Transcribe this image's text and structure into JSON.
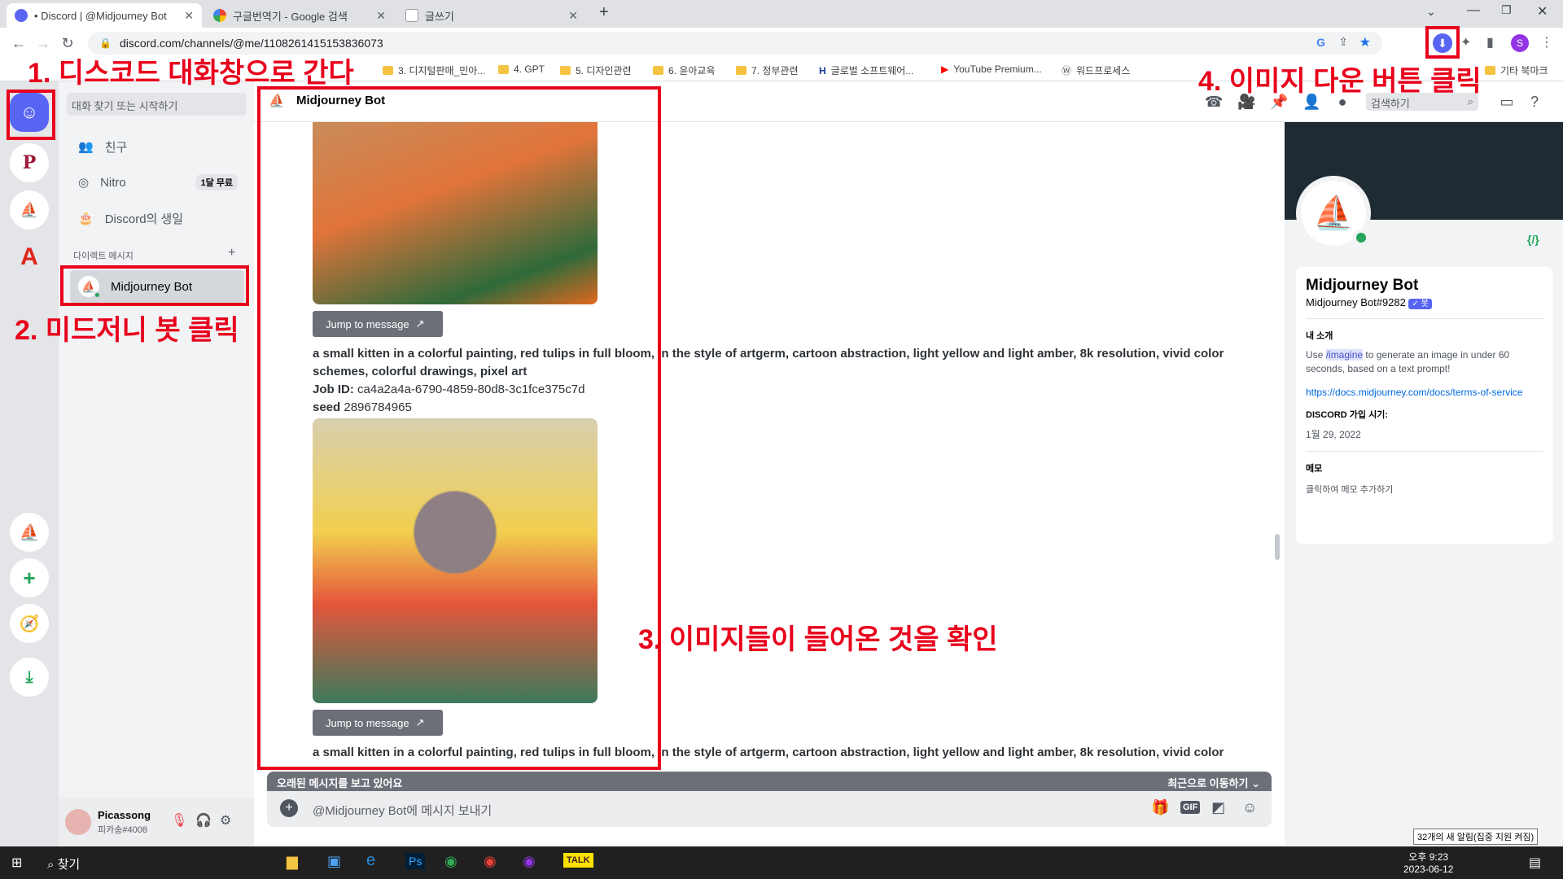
{
  "browser": {
    "tabs": [
      {
        "label": "• Discord | @Midjourney Bot"
      },
      {
        "label": "구글번역기 - Google 검색"
      },
      {
        "label": "글쓰기"
      }
    ],
    "new_tab": "+",
    "url": "discord.com/channels/@me/1108261415153836073",
    "bookmarks": [
      "3. 디지털판매_민아...",
      "4. GPT",
      "5. 디자인관련",
      "6. 윤아교육",
      "7. 정부관련",
      "글로벌 소프트웨어...",
      "YouTube Premium...",
      "워드프로세스",
      "기타 북마크"
    ],
    "profile_letter": "S"
  },
  "discord": {
    "search_placeholder": "대화 찾기 또는 시작하기",
    "friends": "친구",
    "nitro": "Nitro",
    "nitro_badge": "1달 무료",
    "shop": "Discord의 생일",
    "dm_header": "다이렉트 메시지",
    "dm_add": "+",
    "dm_selected": "Midjourney Bot",
    "user": {
      "name": "Picassong",
      "tag": "피카송#4008"
    },
    "header_title": "Midjourney Bot",
    "header_search": "검색하기",
    "jump_label": "Jump to message",
    "prompt": "a small kitten in a colorful painting, red tulips in full bloom, in the style of artgerm, cartoon abstraction, light yellow and light amber, 8k resolution, vivid color schemes, colorful drawings, pixel art",
    "job_label": "Job ID:",
    "job_id": "ca4a2a4a-6790-4859-80d8-3c1fce375c7d",
    "seed_label": "seed",
    "seed": "2896784965",
    "prompt2": "a small kitten in a colorful painting, red tulips in full bloom, in the style of artgerm, cartoon abstraction, light yellow and light amber, 8k resolution, vivid color",
    "older_banner": "오래된 메시지를 보고 있어요",
    "jump_recent": "최근으로 이동하기",
    "composer_placeholder": "@Midjourney Bot에 메시지 보내기",
    "gif": "GIF",
    "profile": {
      "name": "Midjourney Bot",
      "tag": "Midjourney Bot#9282",
      "bot_badge": "✓ 봇",
      "about_h": "내 소개",
      "about_pre": "Use ",
      "about_cmd": "/imagine",
      "about_post": " to generate an image in under 60 seconds, based on a text prompt!",
      "link": "https://docs.midjourney.com/docs/terms-of-service",
      "joined_h": "DISCORD 가입 시기:",
      "joined": "1월 29, 2022",
      "memo_h": "메모",
      "memo": "클릭하여 메모 추가하기",
      "code_icon": "{/}"
    }
  },
  "annotations": {
    "step1": "1. 디스코드 대화창으로 간다",
    "step2": "2. 미드저니 봇 클릭",
    "step3": "3. 이미지들이 들어온 것을 확인",
    "step4": "4. 이미지 다운 버튼 클릭"
  },
  "taskbar": {
    "search": "찾기",
    "time": "오후 9:23",
    "date": "2023-06-12",
    "notify": "32개의 새 알림(집중 지원 켜짐)"
  }
}
